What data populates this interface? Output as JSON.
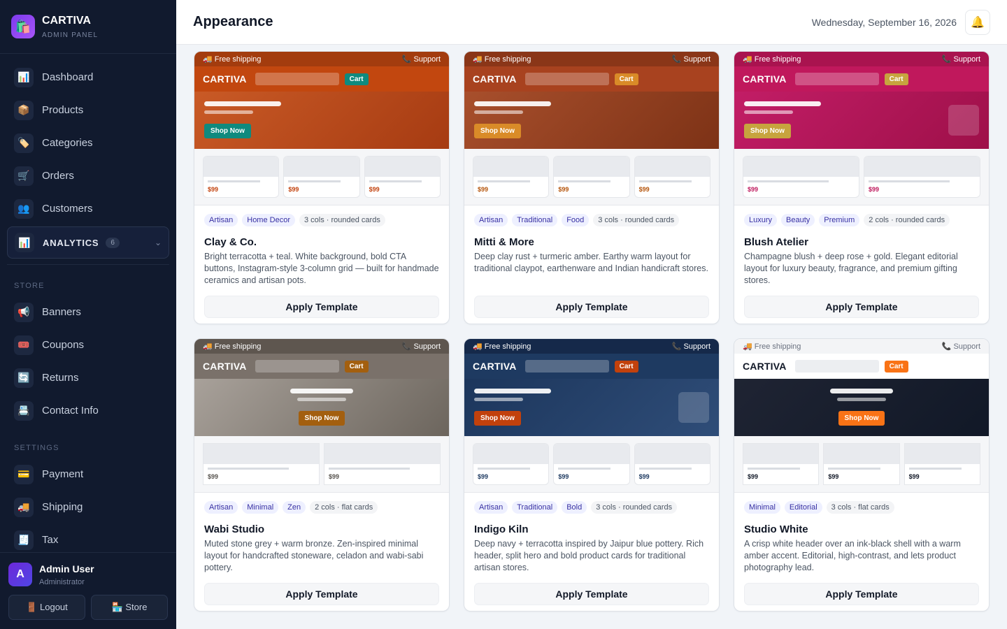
{
  "app": {
    "name": "CARTIVA",
    "subtitle": "ADMIN PANEL"
  },
  "nav": {
    "main": [
      {
        "label": "Dashboard",
        "icon": "📊"
      },
      {
        "label": "Products",
        "icon": "📦"
      },
      {
        "label": "Categories",
        "icon": "🏷️"
      },
      {
        "label": "Orders",
        "icon": "🛒"
      },
      {
        "label": "Customers",
        "icon": "👥"
      }
    ],
    "analytics": {
      "label": "ANALYTICS",
      "icon": "📊",
      "count": "6"
    },
    "store_label": "STORE",
    "store": [
      {
        "label": "Banners",
        "icon": "📢"
      },
      {
        "label": "Coupons",
        "icon": "🎟️"
      },
      {
        "label": "Returns",
        "icon": "🔄"
      },
      {
        "label": "Contact Info",
        "icon": "📇"
      }
    ],
    "settings_label": "SETTINGS",
    "settings": [
      {
        "label": "Payment",
        "icon": "💳"
      },
      {
        "label": "Shipping",
        "icon": "🚚"
      },
      {
        "label": "Tax",
        "icon": "🧾"
      }
    ]
  },
  "user": {
    "initial": "A",
    "name": "Admin User",
    "role": "Administrator",
    "logout": "🚪 Logout",
    "store": "🏪 Store"
  },
  "header": {
    "title": "Appearance",
    "date": "Wednesday, September 16, 2026",
    "bell": "🔔"
  },
  "preview_text": {
    "shipping": "🚚 Free shipping",
    "support": "📞 Support",
    "brand": "CARTIVA",
    "cart": "Cart",
    "cta": "Shop Now",
    "price": "$99"
  },
  "apply_label": "Apply Template",
  "templates": [
    {
      "name": "Clay & Co.",
      "tags": [
        "Artisan",
        "Home Decor"
      ],
      "meta": "3 cols · rounded cards",
      "description": "Bright terracotta + teal. White background, bold CTA buttons, Instagram-style 3-column grid — built for handmade ceramics and artisan pots.",
      "colors": {
        "top": "#a33c0e",
        "topText": "#ffffff",
        "head": "#c2470f",
        "headText": "#ffffff",
        "search": "rgba(255,255,255,0.25)",
        "cart": "#0f8a7e",
        "cartText": "#ffffff",
        "hero": "linear-gradient(135deg,#c95a26,#a63b12)",
        "cta": "#0f8a7e",
        "ctaText": "#ffffff",
        "price": "#c2410c"
      },
      "columns": 3,
      "rounded": true,
      "heroAlign": "left",
      "heroImage": false
    },
    {
      "name": "Mitti & More",
      "tags": [
        "Artisan",
        "Traditional",
        "Food"
      ],
      "meta": "3 cols · rounded cards",
      "description": "Deep clay rust + turmeric amber. Earthy warm layout for traditional claypot, earthenware and Indian handicraft stores.",
      "colors": {
        "top": "#8a3618",
        "topText": "#ffffff",
        "head": "#a8421f",
        "headText": "#ffffff",
        "search": "rgba(255,255,255,0.25)",
        "cart": "#d98b28",
        "cartText": "#ffffff",
        "hero": "linear-gradient(135deg,#a84f2c,#7d3216)",
        "cta": "#d98b28",
        "ctaText": "#ffffff",
        "price": "#b45309"
      },
      "columns": 3,
      "rounded": true,
      "heroAlign": "left",
      "heroImage": false
    },
    {
      "name": "Blush Atelier",
      "tags": [
        "Luxury",
        "Beauty",
        "Premium"
      ],
      "meta": "2 cols · rounded cards",
      "description": "Champagne blush + deep rose + gold. Elegant editorial layout for luxury beauty, fragrance, and premium gifting stores.",
      "colors": {
        "top": "#a9134f",
        "topText": "#ffffff",
        "head": "#c0185c",
        "headText": "#ffffff",
        "search": "rgba(255,255,255,0.25)",
        "cart": "#c7a43e",
        "cartText": "#ffffff",
        "hero": "linear-gradient(135deg,#c21d66,#9e1049)",
        "cta": "#c7a43e",
        "ctaText": "#ffffff",
        "price": "#be185d"
      },
      "columns": 2,
      "rounded": true,
      "heroAlign": "left",
      "heroImage": true
    },
    {
      "name": "Wabi Studio",
      "tags": [
        "Artisan",
        "Minimal",
        "Zen"
      ],
      "meta": "2 cols · flat cards",
      "description": "Muted stone grey + warm bronze. Zen-inspired minimal layout for handcrafted stoneware, celadon and wabi-sabi pottery.",
      "colors": {
        "top": "#5e564f",
        "topText": "#ffffff",
        "head": "#7a716a",
        "headText": "#ffffff",
        "search": "rgba(255,255,255,0.25)",
        "cart": "#a35f0f",
        "cartText": "#ffffff",
        "hero": "linear-gradient(135deg,#a8a19a,#6c655d)",
        "cta": "#a35f0f",
        "ctaText": "#ffffff",
        "price": "#57534e"
      },
      "columns": 2,
      "rounded": false,
      "heroAlign": "center",
      "heroImage": false
    },
    {
      "name": "Indigo Kiln",
      "tags": [
        "Artisan",
        "Traditional",
        "Bold"
      ],
      "meta": "3 cols · rounded cards",
      "description": "Deep navy + terracotta inspired by Jaipur blue pottery. Rich header, split hero and bold product cards for traditional artisan stores.",
      "colors": {
        "top": "#15294a",
        "topText": "#ffffff",
        "head": "#1e3a61",
        "headText": "#ffffff",
        "search": "rgba(255,255,255,0.25)",
        "cart": "#c2410c",
        "cartText": "#ffffff",
        "hero": "linear-gradient(135deg,#1c365c,#2f4d78)",
        "cta": "#c2410c",
        "ctaText": "#ffffff",
        "price": "#1e3a61"
      },
      "columns": 3,
      "rounded": true,
      "heroAlign": "left",
      "heroImage": true
    },
    {
      "name": "Studio White",
      "tags": [
        "Minimal",
        "Editorial"
      ],
      "meta": "3 cols · flat cards",
      "description": "A crisp white header over an ink-black shell with a warm amber accent. Editorial, high-contrast, and lets product photography lead.",
      "colors": {
        "top": "#f3f4f6",
        "topText": "#6b7280",
        "head": "#ffffff",
        "headText": "#111827",
        "search": "#eceef1",
        "cart": "#f97316",
        "cartText": "#ffffff",
        "hero": "linear-gradient(135deg,#1f2433,#111827)",
        "cta": "#f97316",
        "ctaText": "#ffffff",
        "price": "#111827"
      },
      "columns": 3,
      "rounded": false,
      "heroAlign": "center",
      "heroImage": false
    }
  ]
}
